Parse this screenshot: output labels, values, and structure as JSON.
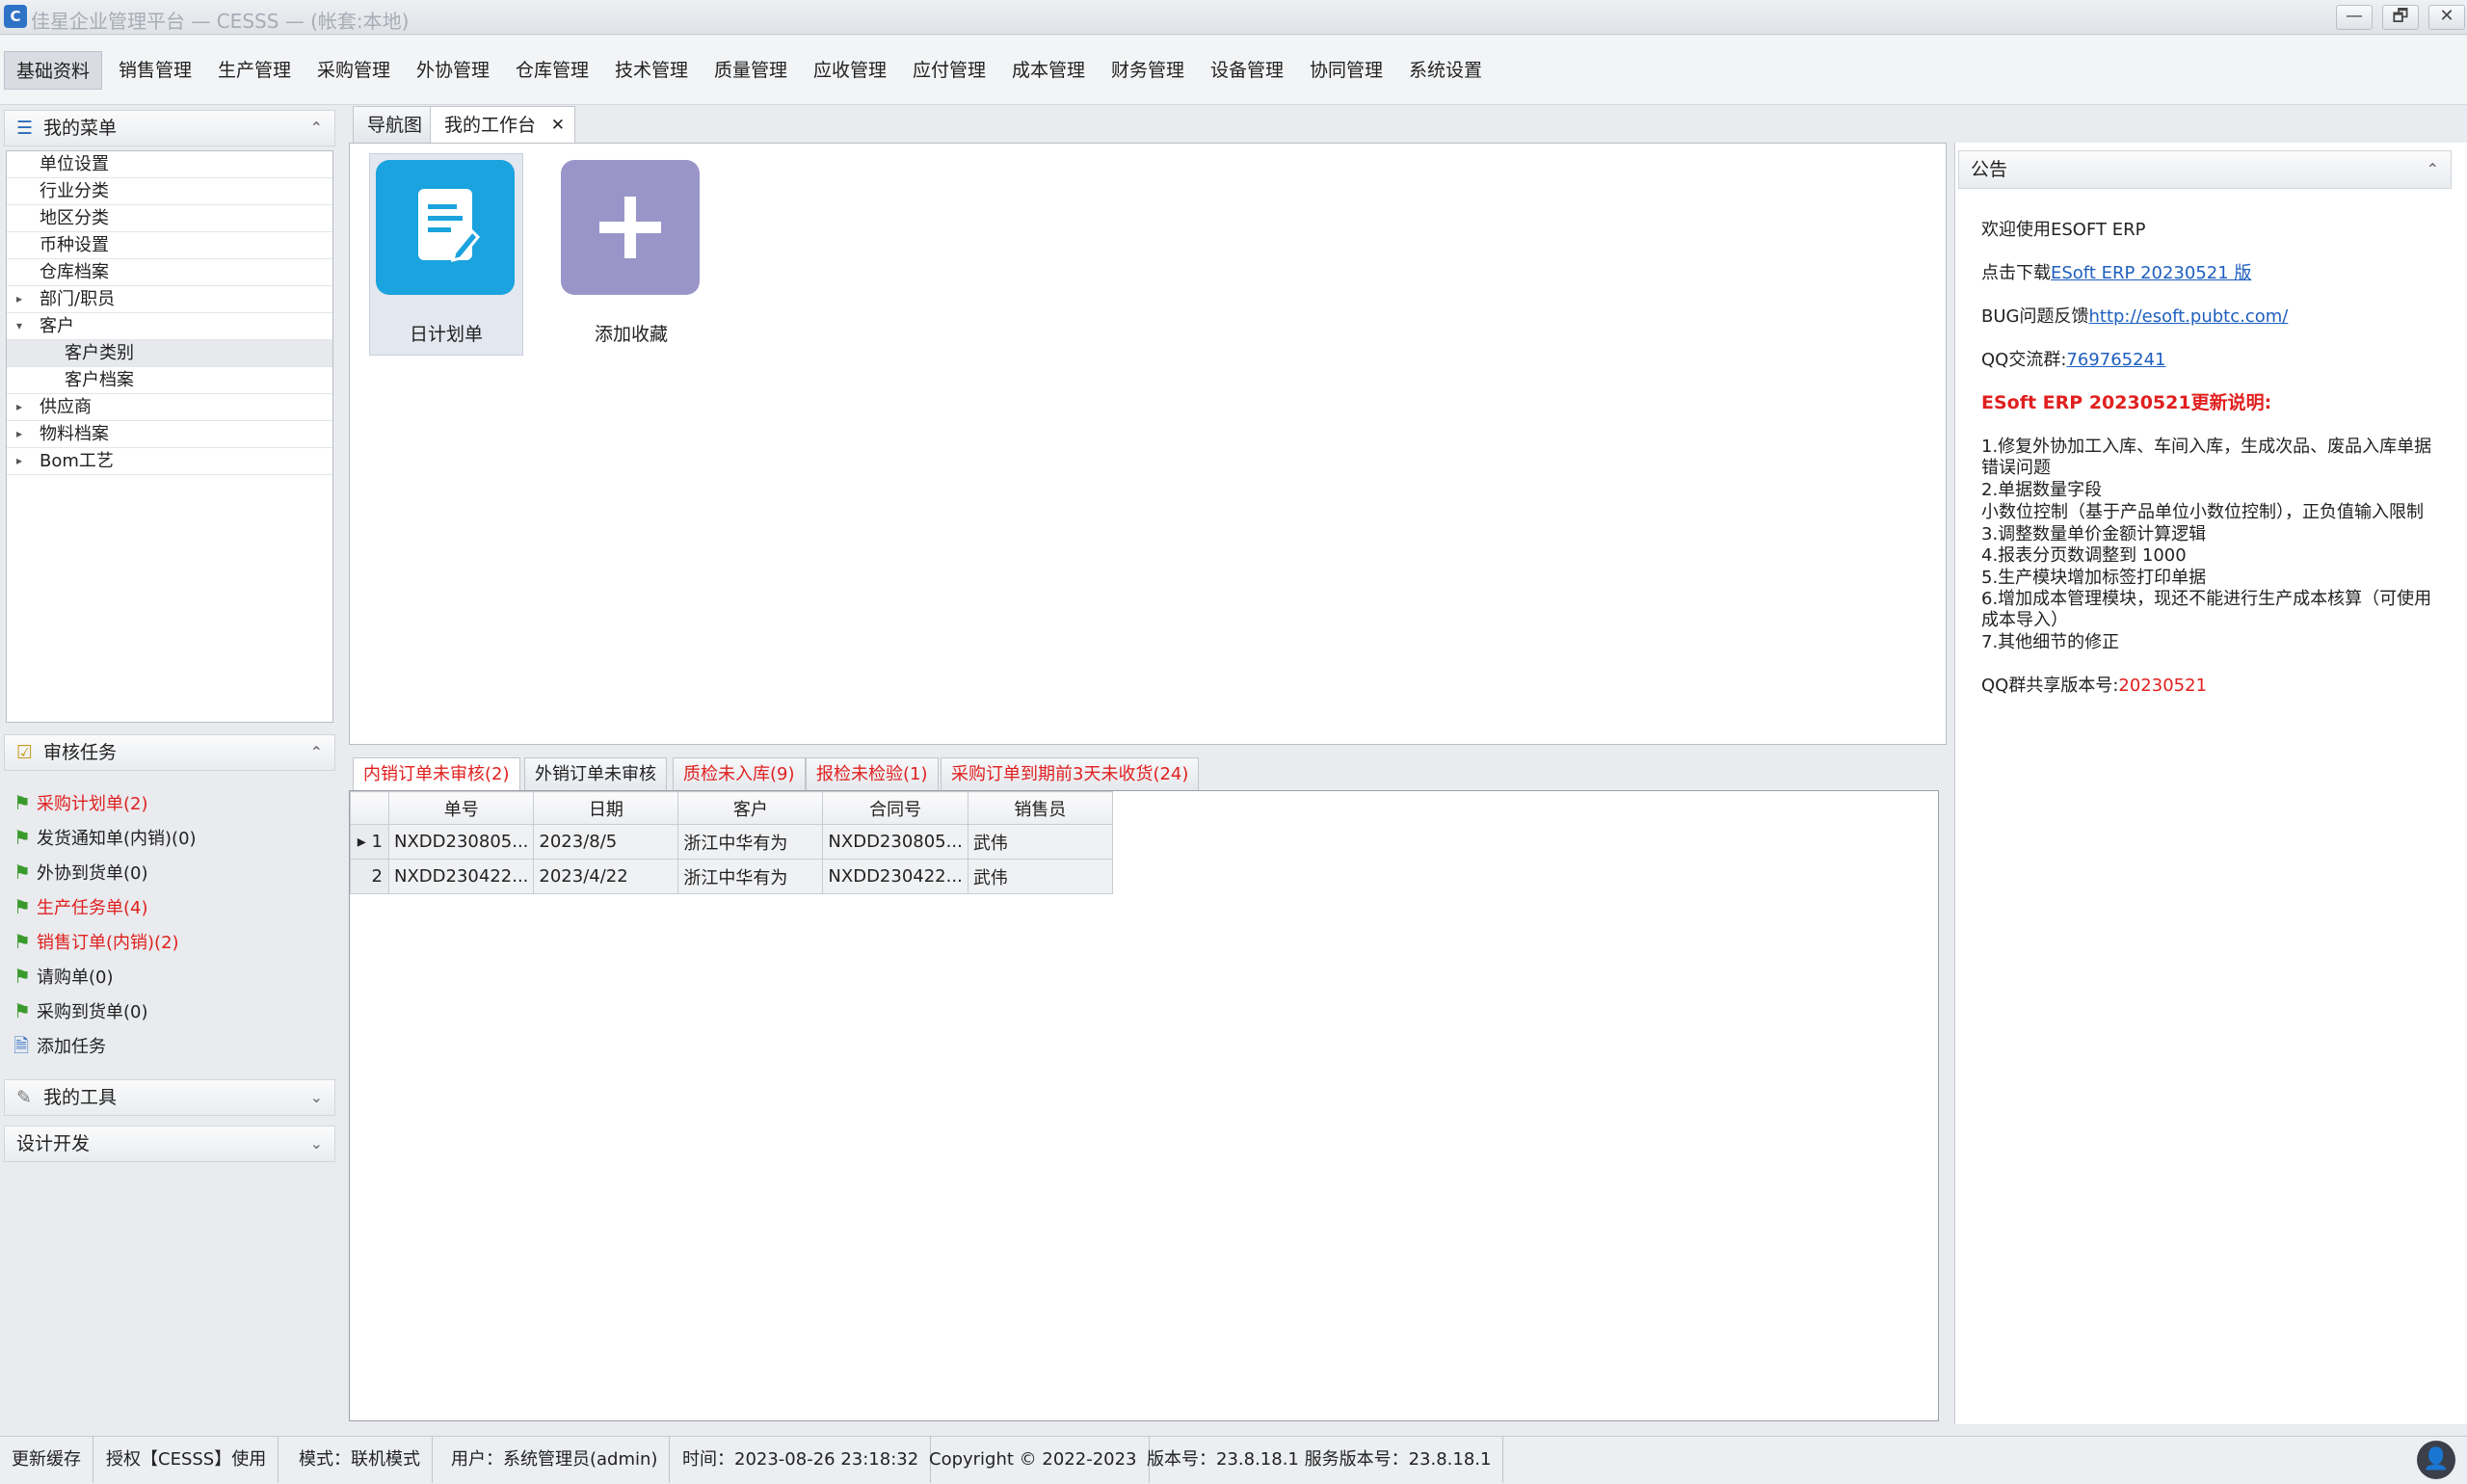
{
  "titlebar": {
    "title": "佳星企业管理平台  — CESSS — (帐套:本地)",
    "min": "—",
    "restore": "🗗",
    "close": "✕"
  },
  "menu": [
    "基础资料",
    "销售管理",
    "生产管理",
    "采购管理",
    "外协管理",
    "仓库管理",
    "技术管理",
    "质量管理",
    "应收管理",
    "应付管理",
    "成本管理",
    "财务管理",
    "设备管理",
    "协同管理",
    "系统设置"
  ],
  "left": {
    "mymenu_title": "我的菜单",
    "tree": [
      {
        "label": "单位设置",
        "level": 1,
        "exp": ""
      },
      {
        "label": "行业分类",
        "level": 1,
        "exp": ""
      },
      {
        "label": "地区分类",
        "level": 1,
        "exp": ""
      },
      {
        "label": "币种设置",
        "level": 1,
        "exp": ""
      },
      {
        "label": "仓库档案",
        "level": 1,
        "exp": ""
      },
      {
        "label": "部门/职员",
        "level": 1,
        "exp": "▸"
      },
      {
        "label": "客户",
        "level": 1,
        "exp": "▾"
      },
      {
        "label": "客户类别",
        "level": 2,
        "exp": ""
      },
      {
        "label": "客户档案",
        "level": 2,
        "exp": ""
      },
      {
        "label": "供应商",
        "level": 1,
        "exp": "▸"
      },
      {
        "label": "物料档案",
        "level": 1,
        "exp": "▸"
      },
      {
        "label": "Bom工艺",
        "level": 1,
        "exp": "▸"
      }
    ],
    "audit_title": "审核任务",
    "tasks": [
      {
        "label": "采购计划单(2)",
        "red": true
      },
      {
        "label": "发货通知单(内销)(0)",
        "red": false
      },
      {
        "label": "外协到货单(0)",
        "red": false
      },
      {
        "label": "生产任务单(4)",
        "red": true
      },
      {
        "label": "销售订单(内销)(2)",
        "red": true
      },
      {
        "label": "请购单(0)",
        "red": false
      },
      {
        "label": "采购到货单(0)",
        "red": false
      }
    ],
    "add_task": "添加任务",
    "tools_title": "我的工具",
    "dev_title": "设计开发"
  },
  "tabs": {
    "nav": "导航图",
    "workbench": "我的工作台",
    "close": "✕"
  },
  "tiles": {
    "daily_plan": "日计划单",
    "add_fav": "添加收藏"
  },
  "bottom_tabs": [
    {
      "label": "内销订单未审核(2)",
      "red": true,
      "active": true
    },
    {
      "label": "外销订单未审核",
      "red": false,
      "active": false
    },
    {
      "label": "质检未入库(9)",
      "red": true,
      "active": false
    },
    {
      "label": "报检未检验(1)",
      "red": true,
      "active": false
    },
    {
      "label": "采购订单到期前3天未收货(24)",
      "red": true,
      "active": false
    }
  ],
  "grid": {
    "columns": [
      "单号",
      "日期",
      "客户",
      "合同号",
      "销售员"
    ],
    "rows": [
      {
        "rh": "▸ 1",
        "cells": [
          "NXDD230805...",
          "2023/8/5",
          "浙江中华有为",
          "NXDD230805...",
          "武伟"
        ]
      },
      {
        "rh": "2",
        "cells": [
          "NXDD230422...",
          "2023/4/22",
          "浙江中华有为",
          "NXDD230422...",
          "武伟"
        ]
      }
    ]
  },
  "announce": {
    "title": "公告",
    "welcome": "欢迎使用ESOFT ERP",
    "download_prefix": "点击下载",
    "download_link": "ESoft ERP 20230521 版",
    "bug_prefix": "BUG问题反馈",
    "bug_link": "http://esoft.pubtc.com/",
    "qq_prefix": "QQ交流群:",
    "qq_link": "769765241",
    "release_title": "ESoft ERP 20230521更新说明:",
    "notes": [
      "1.修复外协加工入库、车间入库，生成次品、废品入库单据错误问题",
      "2.单据数量字段",
      "小数位控制（基于产品单位小数位控制），正负值输入限制",
      "3.调整数量单价金额计算逻辑",
      "4.报表分页数调整到 1000",
      "5.生产模块增加标签打印单据",
      "6.增加成本管理模块，现还不能进行生产成本核算（可使用成本导入）",
      "7.其他细节的修正"
    ],
    "version_prefix": "QQ群共享版本号:",
    "version": "20230521"
  },
  "status": [
    "更新缓存",
    "授权【CESSS】使用",
    "模式：联机模式",
    "用户：系统管理员(admin)",
    "时间：2023-08-26 23:18:32",
    "Copyright © 2022-2023",
    "版本号：23.8.18.1 服务版本号：23.8.18.1"
  ]
}
